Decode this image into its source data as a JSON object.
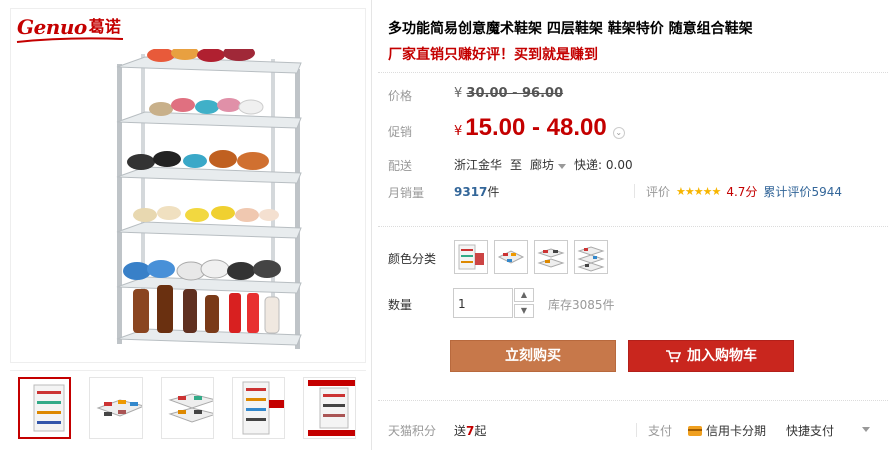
{
  "brand": {
    "latin": "Genuo",
    "cn": "葛诺"
  },
  "product": {
    "title": "多功能简易创意魔术鞋架 四层鞋架 鞋架特价 随意组合鞋架",
    "subtitle": "厂家直销只赚好评！买到就是赚到"
  },
  "price": {
    "label": "价格",
    "currency": "¥",
    "original": "30.00 - 96.00",
    "promo_label": "促销",
    "promo": "15.00 - 48.00"
  },
  "shipping": {
    "label": "配送",
    "from": "浙江金华",
    "to_word": "至",
    "dest": "廊坊",
    "fee": "快递: 0.00"
  },
  "sales": {
    "label": "月销量",
    "count": "9317",
    "unit": "件"
  },
  "rating": {
    "label": "评价",
    "stars": "★★★★★",
    "score": "4.7分",
    "total_label": "累计评价",
    "total": "5944",
    "score_value": 4.7
  },
  "options": {
    "color_label": "颜色分类",
    "quantity_label": "数量",
    "quantity_value": "1",
    "stock": "库存3085件"
  },
  "actions": {
    "buy": "立刻购买",
    "cart": "加入购物车"
  },
  "footer": {
    "points_label": "天猫积分",
    "points_prefix": "送",
    "points_value": "7",
    "points_suffix": "起",
    "pay_label": "支付",
    "pay_card": "信用卡分期",
    "pay_fast": "快捷支付"
  },
  "thumbnails": [
    {
      "name": "thumb-1",
      "tag": ""
    },
    {
      "name": "thumb-2",
      "tag": ""
    },
    {
      "name": "thumb-3",
      "tag": ""
    },
    {
      "name": "thumb-4",
      "tag": ""
    },
    {
      "name": "thumb-5",
      "tag": ""
    }
  ],
  "colors": {
    "accent": "#c40000",
    "buy_button": "#c7784a",
    "cart_button": "#c9261e",
    "link": "#336699",
    "star": "#f7b500"
  }
}
